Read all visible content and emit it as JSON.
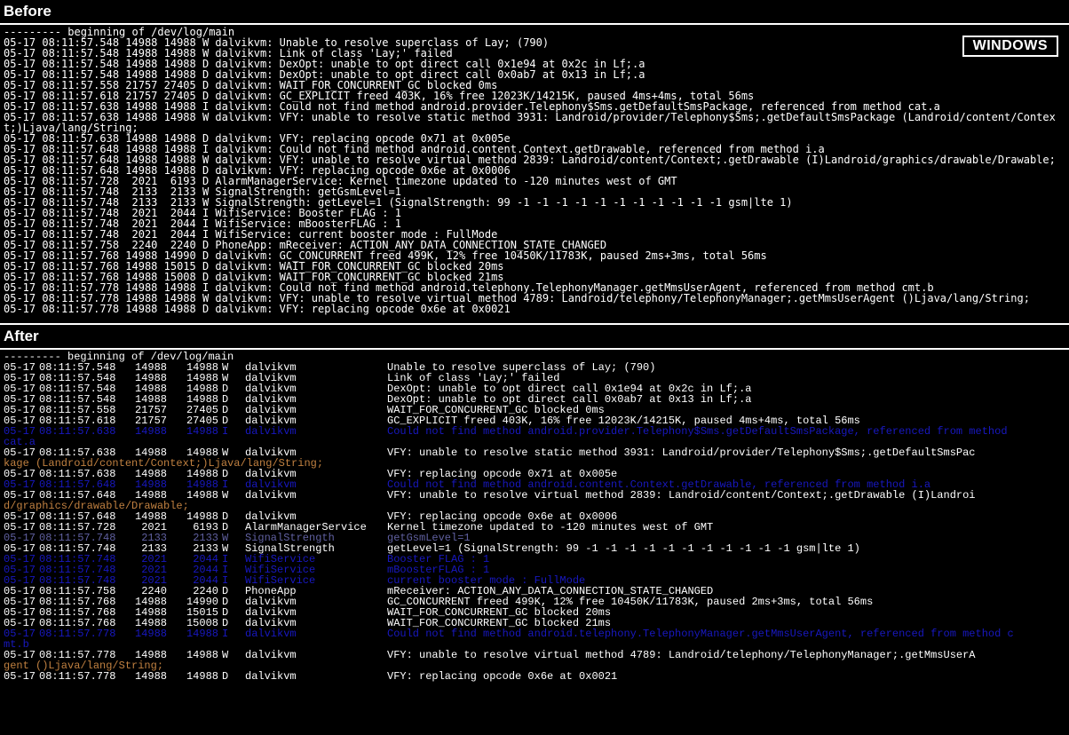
{
  "badge": "WINDOWS",
  "titles": {
    "before": "Before",
    "after": "After"
  },
  "banner": "--------- beginning of /dev/log/main",
  "before_lines": [
    "05-17 08:11:57.548 14988 14988 W dalvikvm: Unable to resolve superclass of Lay; (790)",
    "05-17 08:11:57.548 14988 14988 W dalvikvm: Link of class 'Lay;' failed",
    "05-17 08:11:57.548 14988 14988 D dalvikvm: DexOpt: unable to opt direct call 0x1e94 at 0x2c in Lf;.a",
    "05-17 08:11:57.548 14988 14988 D dalvikvm: DexOpt: unable to opt direct call 0x0ab7 at 0x13 in Lf;.a",
    "05-17 08:11:57.558 21757 27405 D dalvikvm: WAIT_FOR_CONCURRENT_GC blocked 0ms",
    "05-17 08:11:57.618 21757 27405 D dalvikvm: GC_EXPLICIT freed 403K, 16% free 12023K/14215K, paused 4ms+4ms, total 56ms",
    "05-17 08:11:57.638 14988 14988 I dalvikvm: Could not find method android.provider.Telephony$Sms.getDefaultSmsPackage, referenced from method cat.a",
    "05-17 08:11:57.638 14988 14988 W dalvikvm: VFY: unable to resolve static method 3931: Landroid/provider/Telephony$Sms;.getDefaultSmsPackage (Landroid/content/Context;)Ljava/lang/String;",
    "05-17 08:11:57.638 14988 14988 D dalvikvm: VFY: replacing opcode 0x71 at 0x005e",
    "05-17 08:11:57.648 14988 14988 I dalvikvm: Could not find method android.content.Context.getDrawable, referenced from method i.a",
    "05-17 08:11:57.648 14988 14988 W dalvikvm: VFY: unable to resolve virtual method 2839: Landroid/content/Context;.getDrawable (I)Landroid/graphics/drawable/Drawable;",
    "05-17 08:11:57.648 14988 14988 D dalvikvm: VFY: replacing opcode 0x6e at 0x0006",
    "05-17 08:11:57.728  2021  6193 D AlarmManagerService: Kernel timezone updated to -120 minutes west of GMT",
    "05-17 08:11:57.748  2133  2133 W SignalStrength: getGsmLevel=1",
    "05-17 08:11:57.748  2133  2133 W SignalStrength: getLevel=1 (SignalStrength: 99 -1 -1 -1 -1 -1 -1 -1 -1 -1 -1 -1 gsm|lte 1)",
    "05-17 08:11:57.748  2021  2044 I WifiService: Booster FLAG : 1",
    "05-17 08:11:57.748  2021  2044 I WifiService: mBoosterFLAG : 1",
    "05-17 08:11:57.748  2021  2044 I WifiService: current booster mode : FullMode",
    "05-17 08:11:57.758  2240  2240 D PhoneApp: mReceiver: ACTION_ANY_DATA_CONNECTION_STATE_CHANGED",
    "05-17 08:11:57.768 14988 14990 D dalvikvm: GC_CONCURRENT freed 499K, 12% free 10450K/11783K, paused 2ms+3ms, total 56ms",
    "05-17 08:11:57.768 14988 15015 D dalvikvm: WAIT_FOR_CONCURRENT_GC blocked 20ms",
    "05-17 08:11:57.768 14988 15008 D dalvikvm: WAIT_FOR_CONCURRENT_GC blocked 21ms",
    "05-17 08:11:57.778 14988 14988 I dalvikvm: Could not find method android.telephony.TelephonyManager.getMmsUserAgent, referenced from method cmt.b",
    "05-17 08:11:57.778 14988 14988 W dalvikvm: VFY: unable to resolve virtual method 4789: Landroid/telephony/TelephonyManager;.getMmsUserAgent ()Ljava/lang/String;",
    "05-17 08:11:57.778 14988 14988 D dalvikvm: VFY: replacing opcode 0x6e at 0x0021"
  ],
  "after_rows": [
    {
      "d": "05-17",
      "t": "08:11:57.548",
      "p": "14988",
      "q": "14988",
      "lvl": "W",
      "tag": "dalvikvm",
      "msg": "Unable to resolve superclass of Lay; (790)",
      "clr": "w"
    },
    {
      "d": "05-17",
      "t": "08:11:57.548",
      "p": "14988",
      "q": "14988",
      "lvl": "W",
      "tag": "dalvikvm",
      "msg": "Link of class 'Lay;' failed",
      "clr": "w"
    },
    {
      "d": "05-17",
      "t": "08:11:57.548",
      "p": "14988",
      "q": "14988",
      "lvl": "D",
      "tag": "dalvikvm",
      "msg": "DexOpt: unable to opt direct call 0x1e94 at 0x2c in Lf;.a",
      "clr": "w"
    },
    {
      "d": "05-17",
      "t": "08:11:57.548",
      "p": "14988",
      "q": "14988",
      "lvl": "D",
      "tag": "dalvikvm",
      "msg": "DexOpt: unable to opt direct call 0x0ab7 at 0x13 in Lf;.a",
      "clr": "w"
    },
    {
      "d": "05-17",
      "t": "08:11:57.558",
      "p": "21757",
      "q": "27405",
      "lvl": "D",
      "tag": "dalvikvm",
      "msg": "WAIT_FOR_CONCURRENT_GC blocked 0ms",
      "clr": "w"
    },
    {
      "d": "05-17",
      "t": "08:11:57.618",
      "p": "21757",
      "q": "27405",
      "lvl": "D",
      "tag": "dalvikvm",
      "msg": "GC_EXPLICIT freed 403K, 16% free 12023K/14215K, paused 4ms+4ms, total 56ms",
      "clr": "w"
    },
    {
      "d": "05-17",
      "t": "08:11:57.638",
      "p": "14988",
      "q": "14988",
      "lvl": "I",
      "tag": "dalvikvm",
      "msg": "Could not find method android.provider.Telephony$Sms.getDefaultSmsPackage, referenced from method cat.a",
      "clr": "b"
    },
    {
      "d": "05-17",
      "t": "08:11:57.638",
      "p": "14988",
      "q": "14988",
      "lvl": "W",
      "tag": "dalvikvm",
      "msg": "VFY: unable to resolve static method 3931: Landroid/provider/Telephony$Sms;.getDefaultSmsPackage (Landroid/content/Context;)Ljava/lang/String;",
      "clr": "w",
      "wrap": "o",
      "wraptext": "kage (Landroid/content/Context;)Ljava/lang/String;"
    },
    {
      "d": "05-17",
      "t": "08:11:57.638",
      "p": "14988",
      "q": "14988",
      "lvl": "D",
      "tag": "dalvikvm",
      "msg": "VFY: replacing opcode 0x71 at 0x005e",
      "clr": "w"
    },
    {
      "d": "05-17",
      "t": "08:11:57.648",
      "p": "14988",
      "q": "14988",
      "lvl": "I",
      "tag": "dalvikvm",
      "msg": "Could not find method android.content.Context.getDrawable, referenced from method i.a",
      "clr": "b"
    },
    {
      "d": "05-17",
      "t": "08:11:57.648",
      "p": "14988",
      "q": "14988",
      "lvl": "W",
      "tag": "dalvikvm",
      "msg": "VFY: unable to resolve virtual method 2839: Landroid/content/Context;.getDrawable (I)Landroid/graphics/drawable/Drawable;",
      "clr": "w",
      "wrap": "o",
      "wraptext": "d/graphics/drawable/Drawable;"
    },
    {
      "d": "05-17",
      "t": "08:11:57.648",
      "p": "14988",
      "q": "14988",
      "lvl": "D",
      "tag": "dalvikvm",
      "msg": "VFY: replacing opcode 0x6e at 0x0006",
      "clr": "w"
    },
    {
      "d": "05-17",
      "t": "08:11:57.728",
      "p": "2021",
      "q": "6193",
      "lvl": "D",
      "tag": "AlarmManagerService",
      "msg": "Kernel timezone updated to -120 minutes west of GMT",
      "clr": "w"
    },
    {
      "d": "05-17",
      "t": "08:11:57.748",
      "p": "2133",
      "q": "2133",
      "lvl": "W",
      "tag": "SignalStrength",
      "msg": "getGsmLevel=1",
      "clr": "m"
    },
    {
      "d": "05-17",
      "t": "08:11:57.748",
      "p": "2133",
      "q": "2133",
      "lvl": "W",
      "tag": "SignalStrength",
      "msg": "getLevel=1 (SignalStrength: 99 -1 -1 -1 -1 -1 -1 -1 -1 -1 -1 -1 gsm|lte 1)",
      "clr": "w"
    },
    {
      "d": "05-17",
      "t": "08:11:57.748",
      "p": "2021",
      "q": "2044",
      "lvl": "I",
      "tag": "WifiService",
      "msg": "Booster FLAG : 1",
      "clr": "b"
    },
    {
      "d": "05-17",
      "t": "08:11:57.748",
      "p": "2021",
      "q": "2044",
      "lvl": "I",
      "tag": "WifiService",
      "msg": "mBoosterFLAG : 1",
      "clr": "b"
    },
    {
      "d": "05-17",
      "t": "08:11:57.748",
      "p": "2021",
      "q": "2044",
      "lvl": "I",
      "tag": "WifiService",
      "msg": "current booster mode : FullMode",
      "clr": "b"
    },
    {
      "d": "05-17",
      "t": "08:11:57.758",
      "p": "2240",
      "q": "2240",
      "lvl": "D",
      "tag": "PhoneApp",
      "msg": "mReceiver: ACTION_ANY_DATA_CONNECTION_STATE_CHANGED",
      "clr": "w"
    },
    {
      "d": "05-17",
      "t": "08:11:57.768",
      "p": "14988",
      "q": "14990",
      "lvl": "D",
      "tag": "dalvikvm",
      "msg": "GC_CONCURRENT freed 499K, 12% free 10450K/11783K, paused 2ms+3ms, total 56ms",
      "clr": "w"
    },
    {
      "d": "05-17",
      "t": "08:11:57.768",
      "p": "14988",
      "q": "15015",
      "lvl": "D",
      "tag": "dalvikvm",
      "msg": "WAIT_FOR_CONCURRENT_GC blocked 20ms",
      "clr": "w"
    },
    {
      "d": "05-17",
      "t": "08:11:57.768",
      "p": "14988",
      "q": "15008",
      "lvl": "D",
      "tag": "dalvikvm",
      "msg": "WAIT_FOR_CONCURRENT_GC blocked 21ms",
      "clr": "w"
    },
    {
      "d": "05-17",
      "t": "08:11:57.778",
      "p": "14988",
      "q": "14988",
      "lvl": "I",
      "tag": "dalvikvm",
      "msg": "Could not find method android.telephony.TelephonyManager.getMmsUserAgent, referenced from method cmt.b",
      "clr": "b"
    },
    {
      "d": "05-17",
      "t": "08:11:57.778",
      "p": "14988",
      "q": "14988",
      "lvl": "W",
      "tag": "dalvikvm",
      "msg": "VFY: unable to resolve virtual method 4789: Landroid/telephony/TelephonyManager;.getMmsUserAgent ()Ljava/lang/String;",
      "clr": "w",
      "wrap": "o",
      "wraptext": "gent ()Ljava/lang/String;"
    },
    {
      "d": "05-17",
      "t": "08:11:57.778",
      "p": "14988",
      "q": "14988",
      "lvl": "D",
      "tag": "dalvikvm",
      "msg": "VFY: replacing opcode 0x6e at 0x0021",
      "clr": "w"
    }
  ]
}
